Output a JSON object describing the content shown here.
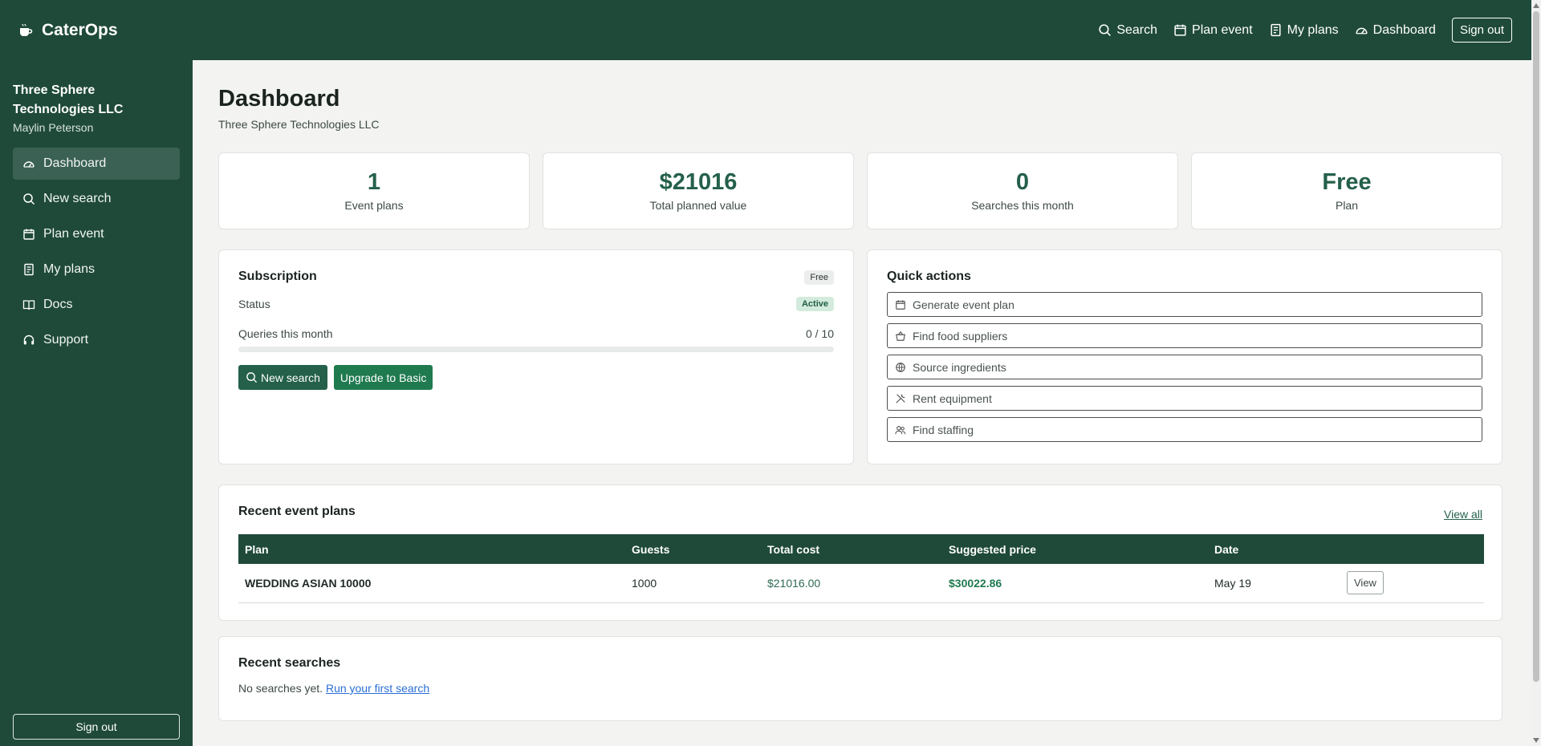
{
  "app": {
    "name": "CaterOps"
  },
  "topnav": {
    "search": "Search",
    "plan_event": "Plan event",
    "my_plans": "My plans",
    "dashboard": "Dashboard",
    "sign_out": "Sign out"
  },
  "sidebar": {
    "org": "Three Sphere Technologies LLC",
    "user": "Maylin Peterson",
    "items": [
      {
        "label": "Dashboard",
        "icon": "gauge-icon",
        "active": true
      },
      {
        "label": "New search",
        "icon": "search-icon",
        "active": false
      },
      {
        "label": "Plan event",
        "icon": "calendar-icon",
        "active": false
      },
      {
        "label": "My plans",
        "icon": "document-icon",
        "active": false
      },
      {
        "label": "Docs",
        "icon": "book-icon",
        "active": false
      },
      {
        "label": "Support",
        "icon": "headset-icon",
        "active": false
      }
    ],
    "sign_out": "Sign out"
  },
  "page": {
    "title": "Dashboard",
    "subtitle": "Three Sphere Technologies LLC"
  },
  "stats": [
    {
      "value": "1",
      "label": "Event plans"
    },
    {
      "value": "$21016",
      "label": "Total planned value"
    },
    {
      "value": "0",
      "label": "Searches this month"
    },
    {
      "value": "Free",
      "label": "Plan"
    }
  ],
  "subscription": {
    "title": "Subscription",
    "plan_badge": "Free",
    "status_label": "Status",
    "status_value": "Active",
    "queries_label": "Queries this month",
    "queries_value": "0 / 10",
    "queries_fraction": 0,
    "new_search": "New search",
    "upgrade": "Upgrade to Basic"
  },
  "quick_actions": {
    "title": "Quick actions",
    "items": [
      {
        "label": "Generate event plan",
        "icon": "calendar-icon"
      },
      {
        "label": "Find food suppliers",
        "icon": "basket-icon"
      },
      {
        "label": "Source ingredients",
        "icon": "globe-icon"
      },
      {
        "label": "Rent equipment",
        "icon": "tools-icon"
      },
      {
        "label": "Find staffing",
        "icon": "people-icon"
      }
    ]
  },
  "recent_plans": {
    "title": "Recent event plans",
    "view_all": "View all",
    "columns": [
      "Plan",
      "Guests",
      "Total cost",
      "Suggested price",
      "Date",
      ""
    ],
    "rows": [
      {
        "plan": "WEDDING ASIAN 10000",
        "guests": "1000",
        "total_cost": "$21016.00",
        "suggested_price": "$30022.86",
        "date": "May 19",
        "action": "View"
      }
    ]
  },
  "recent_searches": {
    "title": "Recent searches",
    "empty_text": "No searches yet.",
    "link": "Run your first search"
  },
  "colors": {
    "brand_dark": "#1f4a3a",
    "accent": "#24604a",
    "button_green": "#1f7a4f",
    "link_blue": "#2b6fd6"
  }
}
